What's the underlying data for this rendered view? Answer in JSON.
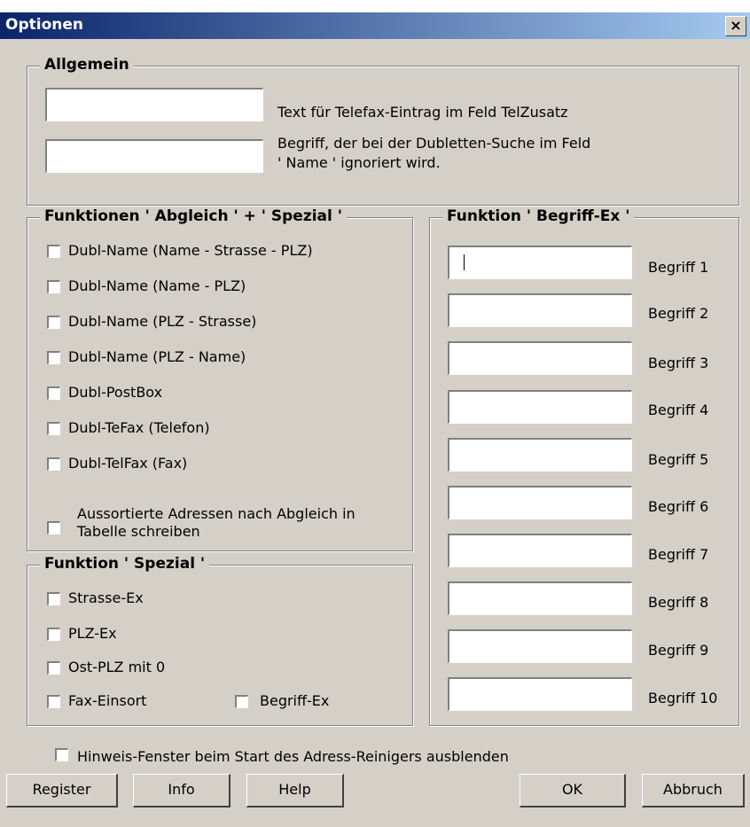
{
  "window": {
    "title": "Optionen",
    "close_glyph": "×"
  },
  "allgemein": {
    "legend": "Allgemein",
    "field1_label": "Text für Telefax-Eintrag im Feld TelZusatz",
    "field2_label_line1": "Begriff, der bei der Dubletten-Suche im Feld",
    "field2_label_line2": "' Name '  ignoriert wird."
  },
  "abgleich": {
    "legend": "Funktionen ' Abgleich ' + ' Spezial '",
    "items": [
      "Dubl-Name  (Name - Strasse - PLZ)",
      "Dubl-Name  (Name - PLZ)",
      "Dubl-Name  (PLZ - Strasse)",
      "Dubl-Name  (PLZ - Name)",
      "Dubl-PostBox",
      "Dubl-TeFax  (Telefon)",
      "Dubl-TelFax  (Fax)"
    ],
    "aussort_line1": "Aussortierte Adressen nach Abgleich in",
    "aussort_line2": "Tabelle schreiben"
  },
  "spezial": {
    "legend": "Funktion  ' Spezial '",
    "items": [
      "Strasse-Ex",
      "PLZ-Ex",
      "Ost-PLZ mit 0",
      "Fax-Einsort"
    ],
    "begriff_ex": "Begriff-Ex"
  },
  "begriff": {
    "legend": "Funktion  ' Begriff-Ex '",
    "labels": [
      "Begriff 1",
      "Begriff 2",
      "Begriff 3",
      "Begriff 4",
      "Begriff 5",
      "Begriff 6",
      "Begriff 7",
      "Begriff 8",
      "Begriff 9",
      "Begriff 10"
    ]
  },
  "hinweis": "Hinweis-Fenster beim Start des Adress-Reinigers ausblenden",
  "buttons": {
    "register": "Register",
    "info": "Info",
    "help": "Help",
    "ok": "OK",
    "abbruch": "Abbruch"
  }
}
